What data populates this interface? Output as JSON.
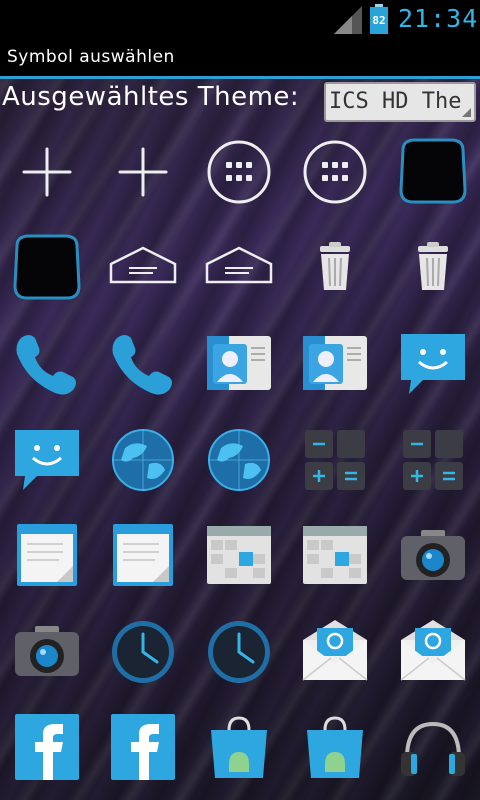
{
  "status_bar": {
    "battery_level": "82",
    "time": "21:34"
  },
  "title_bar": {
    "title": "Symbol auswählen"
  },
  "theme_selector": {
    "label": "Ausgewähltes Theme:",
    "selected_value": "ICS HD The"
  },
  "colors": {
    "accent": "#33b5e5",
    "title_underline": "#2e9fd4"
  },
  "icons": [
    "plus-icon",
    "plus-icon",
    "app-drawer-icon",
    "app-drawer-icon",
    "rounded-square-icon",
    "rounded-square-icon",
    "dock-tray-icon",
    "dock-tray-icon",
    "trash-icon",
    "trash-icon",
    "phone-icon",
    "phone-icon",
    "contacts-icon",
    "contacts-icon",
    "messaging-icon",
    "messaging-icon",
    "browser-globe-icon",
    "browser-globe-icon",
    "calculator-icon",
    "calculator-icon",
    "notes-icon",
    "notes-icon",
    "calendar-icon",
    "calendar-icon",
    "camera-icon",
    "camera-icon",
    "clock-icon",
    "clock-icon",
    "email-icon",
    "email-icon",
    "facebook-icon",
    "facebook-icon",
    "play-store-bag-icon",
    "play-store-bag-icon",
    "headphones-icon"
  ]
}
